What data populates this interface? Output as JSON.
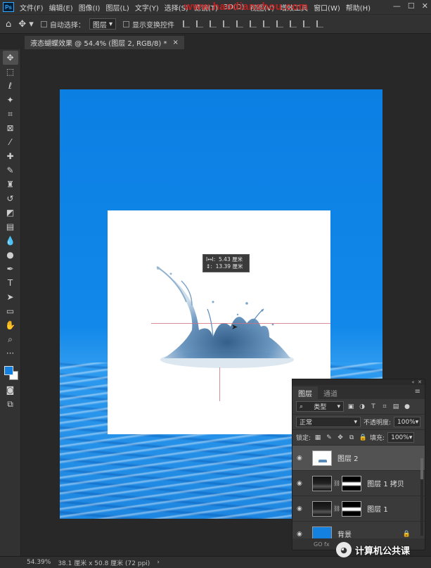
{
  "app": {
    "logo": "Ps",
    "menu": [
      "文件(F)",
      "编辑(E)",
      "图像(I)",
      "图层(L)",
      "文字(Y)",
      "选择(S)",
      "滤镜(T)",
      "3D(D)",
      "视图(V)",
      "增效工具",
      "窗口(W)",
      "帮助(H)"
    ],
    "watermark_url": "www.haodianshou.com"
  },
  "options": {
    "auto_select_label": "自动选择：",
    "auto_select_value": "图层",
    "show_transform_label": "显示变换控件"
  },
  "document": {
    "tab_title": "液态蝴蝶效果 @ 54.4% (图层 2, RGB/8) *",
    "close": "×"
  },
  "measure": {
    "w_label": "I↔I:",
    "w_value": "5.43 厘米",
    "h_label": "↕:",
    "h_value": "13.39 厘米"
  },
  "layers_panel": {
    "tabs": [
      "图层",
      "通道"
    ],
    "filter_label": "类型",
    "blend_mode": "正常",
    "opacity_label": "不透明度:",
    "opacity_value": "100%",
    "lock_label": "锁定:",
    "fill_label": "填充:",
    "fill_value": "100%",
    "layers": [
      {
        "name": "图层 2",
        "selected": true
      },
      {
        "name": "图层 1 拷贝",
        "selected": false
      },
      {
        "name": "图层 1",
        "selected": false
      },
      {
        "name": "背景",
        "selected": false
      }
    ],
    "footer": "GO fx"
  },
  "status": {
    "zoom": "54.39%",
    "doc_size": "38.1 厘米 x 50.8 厘米 (72 ppi)"
  },
  "wechat_brand": "计算机公共课",
  "colors": {
    "foreground": "#1480e0",
    "background": "#ffffff",
    "canvas_blue": "#0c7fe3"
  }
}
